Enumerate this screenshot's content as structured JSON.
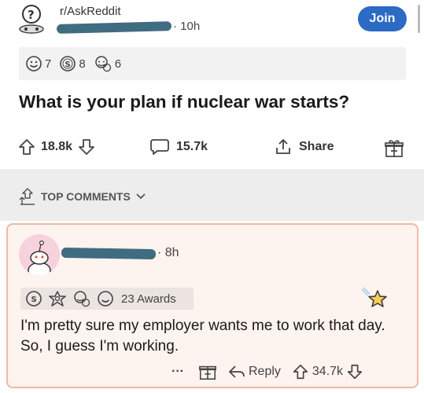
{
  "post": {
    "subreddit": "r/AskReddit",
    "age": "· 10h",
    "join_label": "Join",
    "awards": [
      {
        "icon": "award-smile-icon",
        "count": "7"
      },
      {
        "icon": "silver-award-icon",
        "count": "8"
      },
      {
        "icon": "award-laugh-icon",
        "count": "6"
      }
    ],
    "title": "What is your plan if nuclear war starts?",
    "upvotes": "18.8k",
    "comments": "15.7k",
    "share_label": "Share"
  },
  "comments_section": {
    "sort_label": "TOP COMMENTS"
  },
  "comment": {
    "age": "· 8h",
    "awards_label": "23 Awards",
    "body": "I'm pretty sure my employer wants me to work that day. So, I guess I'm working.",
    "more_label": "···",
    "reply_label": "Reply",
    "score": "34.7k"
  },
  "colors": {
    "join": "#2b6bc4",
    "redaction": "#3f6c80",
    "card_border": "#f0b8a6",
    "card_bg": "#fdf3ef"
  }
}
